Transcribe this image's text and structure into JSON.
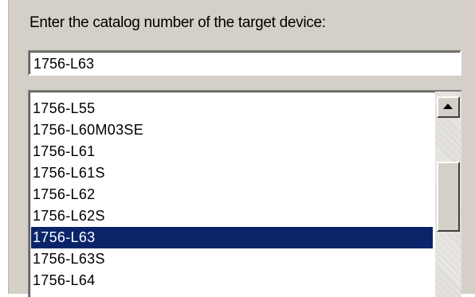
{
  "dialog": {
    "prompt": "Enter the catalog number of the target device:",
    "catalog_input_value": "1756-L63"
  },
  "catalog_list": {
    "items": [
      "1756-L55",
      "1756-L60M03SE",
      "1756-L61",
      "1756-L61S",
      "1756-L62",
      "1756-L62S",
      "1756-L63",
      "1756-L63S",
      "1756-L64"
    ],
    "selected_item": "1756-L63"
  },
  "colors": {
    "dialog_background": "#d4d0c8",
    "selection_highlight": "#0a246a"
  },
  "icons": {
    "scroll_up": "triangle-up-icon"
  }
}
